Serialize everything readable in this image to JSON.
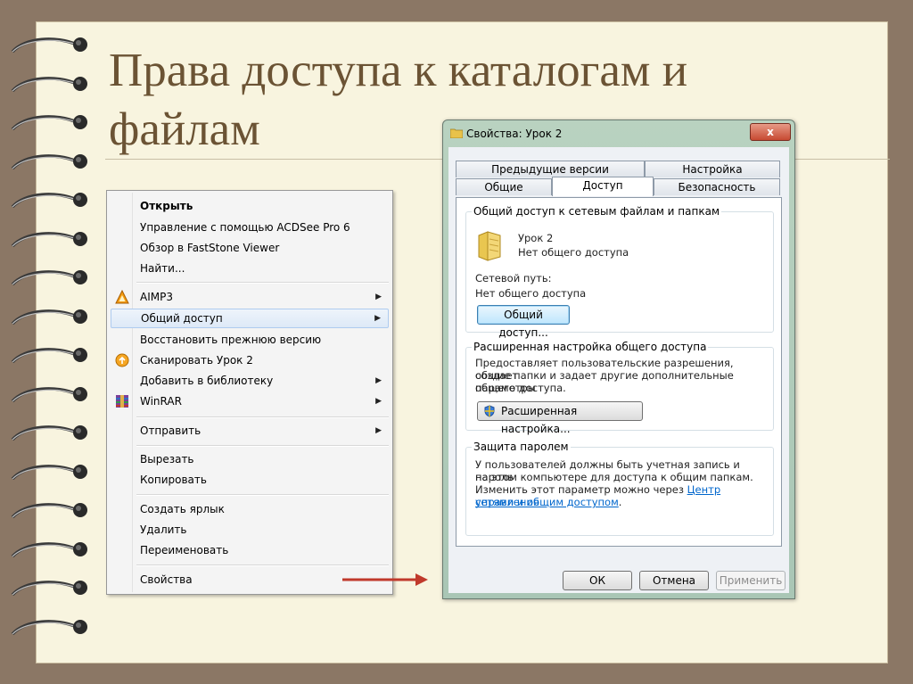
{
  "slide": {
    "title": "Права доступа к каталогам и файлам",
    "colors": {
      "paper": "#f8f4df",
      "title": "#6b5334",
      "background": "#8b7765",
      "arrow": "#c0392b"
    }
  },
  "context_menu": {
    "items": [
      {
        "label": "Открыть",
        "bold": true
      },
      {
        "label": "Управление с помощью ACDSee Pro 6"
      },
      {
        "label": "Обзор в FastStone Viewer"
      },
      {
        "label": "Найти..."
      },
      {
        "label": "AIMP3",
        "icon": "aimp-icon",
        "submenu": true
      },
      {
        "label": "Общий доступ",
        "submenu": true,
        "highlighted": true
      },
      {
        "label": "Восстановить прежнюю версию"
      },
      {
        "label": "Сканировать Урок 2",
        "icon": "scan-icon"
      },
      {
        "label": "Добавить в библиотеку",
        "submenu": true
      },
      {
        "label": "WinRAR",
        "icon": "winrar-icon",
        "submenu": true
      },
      {
        "label": "Отправить",
        "submenu": true
      },
      {
        "label": "Вырезать"
      },
      {
        "label": "Копировать"
      },
      {
        "label": "Создать ярлык"
      },
      {
        "label": "Удалить"
      },
      {
        "label": "Переименовать"
      },
      {
        "label": "Свойства"
      }
    ]
  },
  "dialog": {
    "title": "Свойства: Урок 2",
    "close_label": "x",
    "tabs_row1": [
      "Предыдущие версии",
      "Настройка"
    ],
    "tabs_row2": [
      "Общие",
      "Доступ",
      "Безопасность"
    ],
    "active_tab": "Доступ",
    "network_sharing": {
      "group_title": "Общий доступ к сетевым файлам и папкам",
      "folder_name": "Урок 2",
      "folder_status": "Нет общего доступа",
      "network_path_label": "Сетевой путь:",
      "network_path_value": "Нет общего доступа",
      "share_button": "Общий доступ..."
    },
    "advanced_sharing": {
      "group_title": "Расширенная настройка общего доступа",
      "description_lines": [
        "Предоставляет пользовательские разрешения, создает",
        "общие папки и задает другие дополнительные параметры",
        "общего доступа."
      ],
      "button": "Расширенная настройка..."
    },
    "password_protection": {
      "group_title": "Защита паролем",
      "line1": "У пользователей должны быть учетная запись и пароль",
      "line2": "на этом компьютере для доступа к общим папкам.",
      "line3_text": "Изменить этот параметр можно через ",
      "line3_link": "Центр управления",
      "line4_link": "сетями и общим доступом",
      "line4_tail": "."
    },
    "buttons": {
      "ok": "ОК",
      "cancel": "Отмена",
      "apply": "Применить"
    }
  }
}
